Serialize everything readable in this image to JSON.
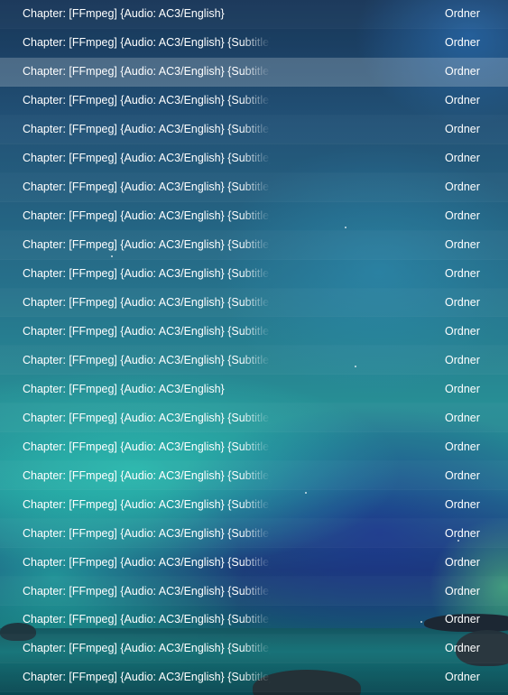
{
  "file_list": {
    "rows": [
      {
        "name": "Chapter: [FFmpeg] {Audio: AC3/English}",
        "type": "Ordner"
      },
      {
        "name": "Chapter: [FFmpeg] {Audio: AC3/English} {Subtitle}",
        "type": "Ordner"
      },
      {
        "name": "Chapter: [FFmpeg] {Audio: AC3/English} {Subtitle}",
        "type": "Ordner"
      },
      {
        "name": "Chapter: [FFmpeg] {Audio: AC3/English} {Subtitle}",
        "type": "Ordner"
      },
      {
        "name": "Chapter: [FFmpeg] {Audio: AC3/English} {Subtitle}",
        "type": "Ordner"
      },
      {
        "name": "Chapter: [FFmpeg] {Audio: AC3/English} {Subtitle}",
        "type": "Ordner"
      },
      {
        "name": "Chapter: [FFmpeg] {Audio: AC3/English} {Subtitle}",
        "type": "Ordner"
      },
      {
        "name": "Chapter: [FFmpeg] {Audio: AC3/English} {Subtitle}",
        "type": "Ordner"
      },
      {
        "name": "Chapter: [FFmpeg] {Audio: AC3/English} {Subtitle}",
        "type": "Ordner"
      },
      {
        "name": "Chapter: [FFmpeg] {Audio: AC3/English} {Subtitle}",
        "type": "Ordner"
      },
      {
        "name": "Chapter: [FFmpeg] {Audio: AC3/English} {Subtitle}",
        "type": "Ordner"
      },
      {
        "name": "Chapter: [FFmpeg] {Audio: AC3/English} {Subtitle}",
        "type": "Ordner"
      },
      {
        "name": "Chapter: [FFmpeg] {Audio: AC3/English} {Subtitle}",
        "type": "Ordner"
      },
      {
        "name": "Chapter: [FFmpeg] {Audio: AC3/English}",
        "type": "Ordner"
      },
      {
        "name": "Chapter: [FFmpeg] {Audio: AC3/English} {Subtitle}",
        "type": "Ordner"
      },
      {
        "name": "Chapter: [FFmpeg] {Audio: AC3/English} {Subtitle}",
        "type": "Ordner"
      },
      {
        "name": "Chapter: [FFmpeg] {Audio: AC3/English} {Subtitle}",
        "type": "Ordner"
      },
      {
        "name": "Chapter: [FFmpeg] {Audio: AC3/English} {Subtitle}",
        "type": "Ordner"
      },
      {
        "name": "Chapter: [FFmpeg] {Audio: AC3/English} {Subtitle}",
        "type": "Ordner"
      },
      {
        "name": "Chapter: [FFmpeg] {Audio: AC3/English} {Subtitle}",
        "type": "Ordner"
      },
      {
        "name": "Chapter: [FFmpeg] {Audio: AC3/English} {Subtitle}",
        "type": "Ordner"
      },
      {
        "name": "Chapter: [FFmpeg] {Audio: AC3/English} {Subtitle}",
        "type": "Ordner"
      },
      {
        "name": "Chapter: [FFmpeg] {Audio: AC3/English} {Subtitle}",
        "type": "Ordner"
      },
      {
        "name": "Chapter: [FFmpeg] {Audio: AC3/English} {Subtitle}",
        "type": "Ordner"
      }
    ]
  },
  "colors": {
    "text": "#ffffff",
    "hover_row": "rgba(255,255,255,0.24)"
  }
}
